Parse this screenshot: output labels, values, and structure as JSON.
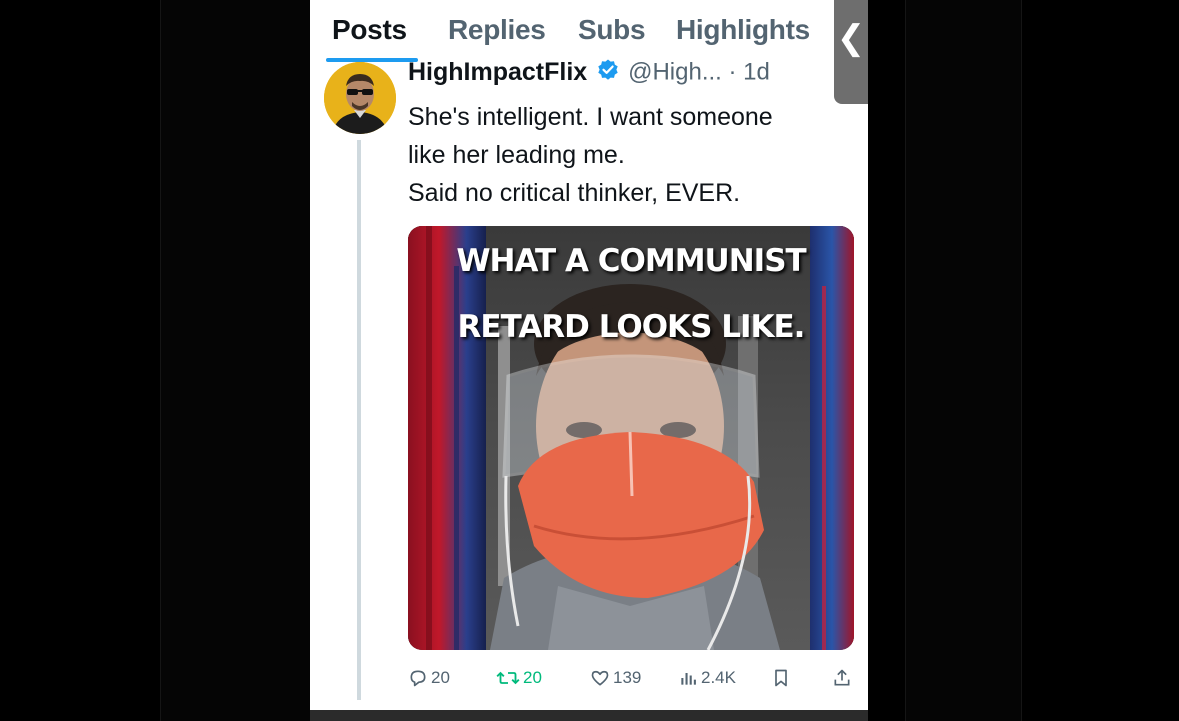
{
  "tabs": [
    {
      "label": "Posts",
      "active": true
    },
    {
      "label": "Replies",
      "active": false
    },
    {
      "label": "Subs",
      "active": false
    },
    {
      "label": "Highlights",
      "active": false
    }
  ],
  "collapse_glyph": "❮",
  "tweet": {
    "author_name": "HighImpactFlix",
    "verified_icon": "verified-badge-icon",
    "handle_time": "@High... · 1d",
    "text_lines": [
      "She's intelligent. I want someone",
      "like her leading me.",
      "Said no critical thinker, EVER."
    ],
    "media": {
      "caption_line1": "WHAT A COMMUNIST",
      "caption_line2": "RETARD LOOKS LIKE."
    },
    "actions": {
      "replies": "20",
      "reposts": "20",
      "likes": "139",
      "views": "2.4K"
    }
  },
  "colors": {
    "accent": "#1d9bf0",
    "repost_green": "#00ba7c",
    "secondary_text": "#536471",
    "primary_text": "#0f1419",
    "avatar_bg": "#e8b21a"
  }
}
